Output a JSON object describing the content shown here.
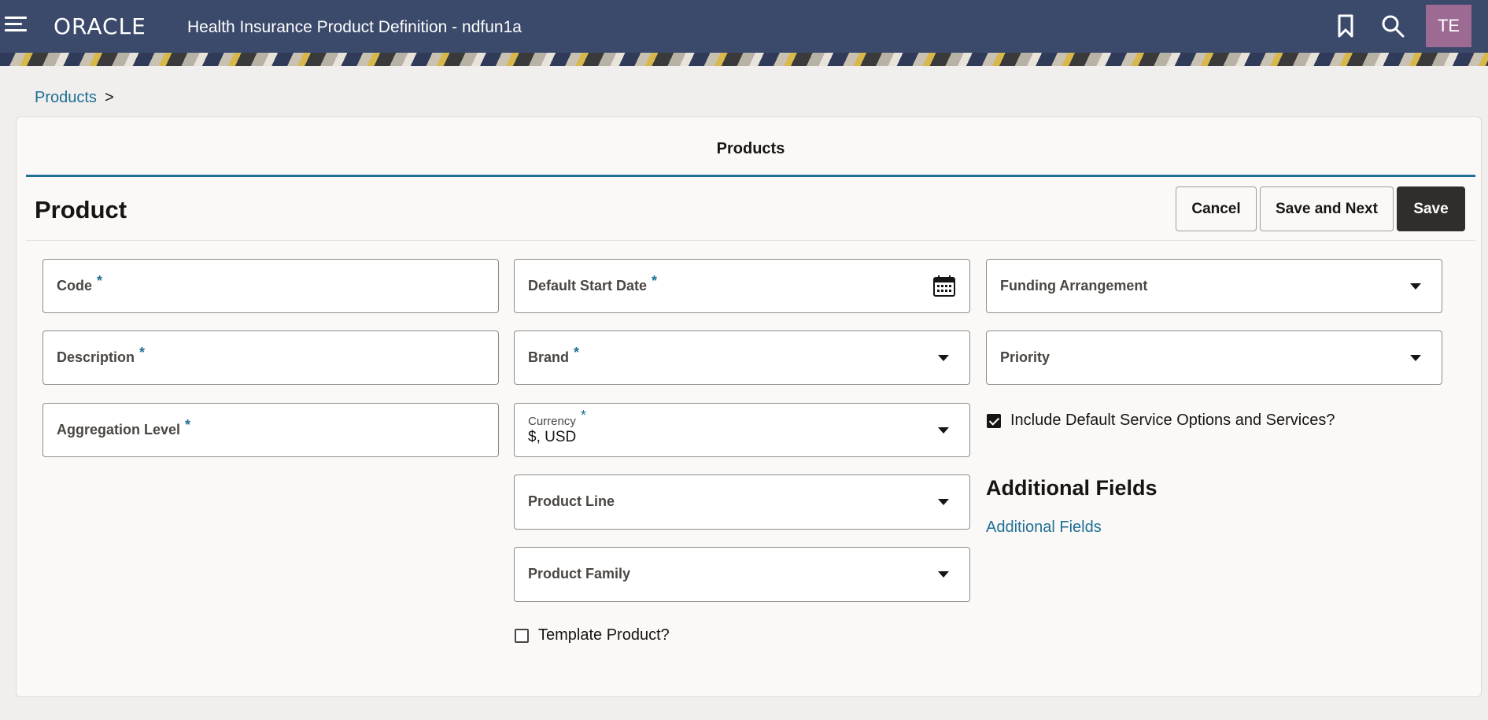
{
  "header": {
    "logo": "ORACLE",
    "app_title": "Health Insurance Product Definition - ndfun1a",
    "avatar_initials": "TE",
    "icons": [
      "menu-icon",
      "bookmark-icon",
      "search-icon"
    ]
  },
  "breadcrumb": {
    "link": "Products",
    "separator": ">"
  },
  "tab": {
    "label": "Products"
  },
  "page": {
    "title": "Product"
  },
  "buttons": {
    "cancel": "Cancel",
    "save_next": "Save and Next",
    "save": "Save"
  },
  "fields": {
    "code": {
      "label": "Code",
      "required": "*"
    },
    "description": {
      "label": "Description",
      "required": "*"
    },
    "aggregation_level": {
      "label": "Aggregation Level",
      "required": "*"
    },
    "default_start_date": {
      "label": "Default Start Date",
      "required": "*"
    },
    "brand": {
      "label": "Brand",
      "required": "*"
    },
    "currency": {
      "label": "Currency",
      "required": "*",
      "value": "$, USD"
    },
    "product_line": {
      "label": "Product Line"
    },
    "product_family": {
      "label": "Product Family"
    },
    "funding_arrangement": {
      "label": "Funding Arrangement"
    },
    "priority": {
      "label": "Priority"
    }
  },
  "checkboxes": {
    "template_product": {
      "label": "Template Product?",
      "checked": false
    },
    "include_default": {
      "label": "Include Default Service Options and Services?",
      "checked": true
    }
  },
  "additional": {
    "heading": "Additional Fields",
    "link": "Additional Fields"
  },
  "colors": {
    "header_bg": "#3b4a6b",
    "accent": "#1e6f94",
    "primary_button": "#312d2a",
    "avatar_bg": "#9c6a92"
  }
}
